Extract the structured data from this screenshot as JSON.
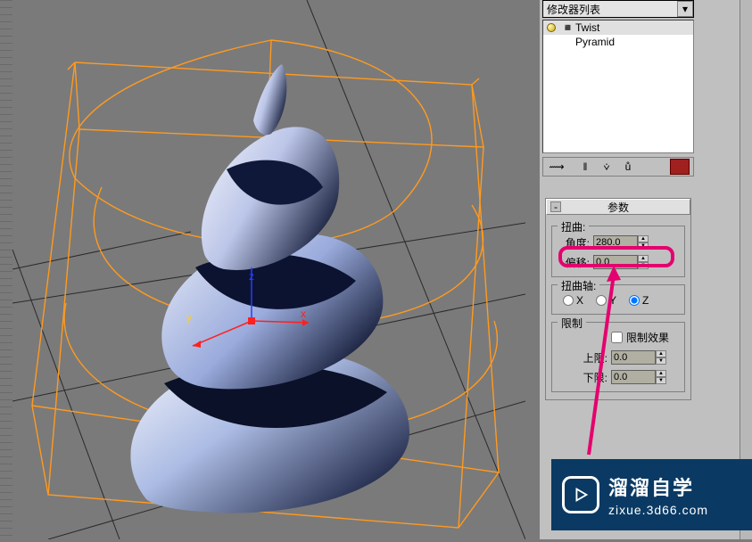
{
  "modifier_list": {
    "dropdown_label": "修改器列表",
    "stack": [
      {
        "label": "Twist",
        "expandable": true,
        "selected": true
      },
      {
        "label": "Pyramid",
        "expandable": false,
        "selected": false
      }
    ]
  },
  "toolbar_icons": {
    "pin": "⇥",
    "divider": "||",
    "vsel1": "▿",
    "vsel2": "▿",
    "trash": "delete"
  },
  "rollout": {
    "title": "参数",
    "twist": {
      "legend": "扭曲:",
      "angle_label": "角度:",
      "angle_value": "280.0",
      "bias_label": "偏移:",
      "bias_value": "0.0"
    },
    "axis": {
      "legend": "扭曲轴:",
      "x": "X",
      "y": "Y",
      "z": "Z",
      "selected": "Z"
    },
    "limits": {
      "legend": "限制",
      "effect_label": "限制效果",
      "effect_checked": false,
      "upper_label": "上限:",
      "upper_value": "0.0",
      "lower_label": "下限:",
      "lower_value": "0.0"
    }
  },
  "viewport": {
    "gizmo_axes": {
      "x": "x",
      "y": "y",
      "z": "z"
    }
  },
  "watermark": {
    "brand": "溜溜自学",
    "url": "zixue.3d66.com"
  }
}
